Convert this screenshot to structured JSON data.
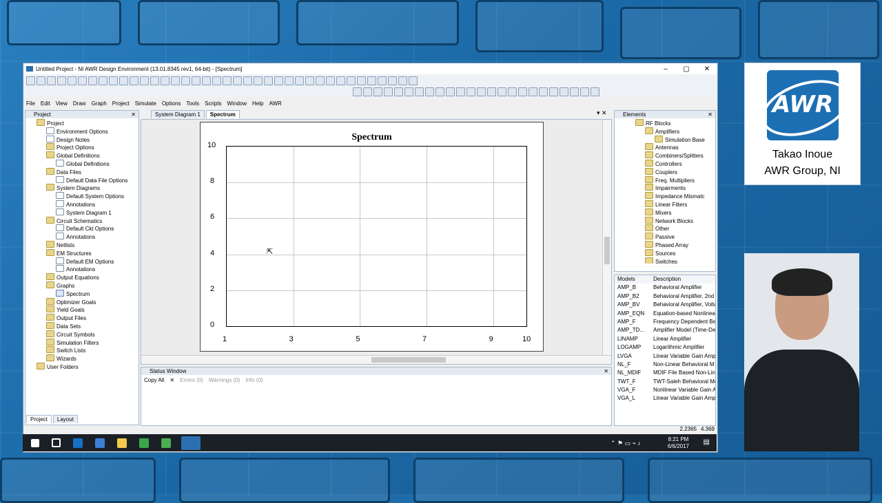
{
  "window": {
    "title": "Untitled Project - NI AWR Design Environment (13.01.8345 rev1, 64-bit) - [Spectrum]",
    "minimize": "–",
    "maximize": "▢",
    "close": "✕"
  },
  "menu": [
    "File",
    "Edit",
    "View",
    "Draw",
    "Graph",
    "Project",
    "Simulate",
    "Options",
    "Tools",
    "Scripts",
    "Window",
    "Help",
    "AWR"
  ],
  "project_panel": {
    "title": "Project",
    "items": [
      {
        "label": "Project",
        "level": 0,
        "icon": "folder"
      },
      {
        "label": "Environment Options",
        "level": 1,
        "icon": "doc"
      },
      {
        "label": "Design Notes",
        "level": 1,
        "icon": "doc"
      },
      {
        "label": "Project Options",
        "level": 1,
        "icon": "folder"
      },
      {
        "label": "Global Definitions",
        "level": 1,
        "icon": "folder"
      },
      {
        "label": "Global Definitions",
        "level": 2,
        "icon": "doc"
      },
      {
        "label": "Data Files",
        "level": 1,
        "icon": "folder"
      },
      {
        "label": "Default Data File Options",
        "level": 2,
        "icon": "doc"
      },
      {
        "label": "System Diagrams",
        "level": 1,
        "icon": "folder"
      },
      {
        "label": "Default System Options",
        "level": 2,
        "icon": "doc"
      },
      {
        "label": "Annotations",
        "level": 2,
        "icon": "doc"
      },
      {
        "label": "System Diagram 1",
        "level": 2,
        "icon": "doc"
      },
      {
        "label": "Circuit Schematics",
        "level": 1,
        "icon": "folder"
      },
      {
        "label": "Default Ckt Options",
        "level": 2,
        "icon": "doc"
      },
      {
        "label": "Annotations",
        "level": 2,
        "icon": "doc"
      },
      {
        "label": "Netlists",
        "level": 1,
        "icon": "folder"
      },
      {
        "label": "EM Structures",
        "level": 1,
        "icon": "folder"
      },
      {
        "label": "Default EM Options",
        "level": 2,
        "icon": "doc"
      },
      {
        "label": "Annotations",
        "level": 2,
        "icon": "doc"
      },
      {
        "label": "Output Equations",
        "level": 1,
        "icon": "folder"
      },
      {
        "label": "Graphs",
        "level": 1,
        "icon": "folder"
      },
      {
        "label": "Spectrum",
        "level": 2,
        "icon": "graph"
      },
      {
        "label": "Optimizer Goals",
        "level": 1,
        "icon": "folder"
      },
      {
        "label": "Yield Goals",
        "level": 1,
        "icon": "folder"
      },
      {
        "label": "Output Files",
        "level": 1,
        "icon": "folder"
      },
      {
        "label": "Data Sets",
        "level": 1,
        "icon": "folder"
      },
      {
        "label": "Circuit Symbols",
        "level": 1,
        "icon": "folder"
      },
      {
        "label": "Simulation Filters",
        "level": 1,
        "icon": "folder"
      },
      {
        "label": "Switch Lists",
        "level": 1,
        "icon": "folder"
      },
      {
        "label": "Wizards",
        "level": 1,
        "icon": "folder"
      },
      {
        "label": "User Folders",
        "level": 0,
        "icon": "folder"
      }
    ],
    "bottom_tabs": [
      "Project",
      "Layout"
    ]
  },
  "doc_tabs": [
    "System Diagram 1",
    "Spectrum"
  ],
  "chart_data": {
    "type": "line",
    "title": "Spectrum",
    "xlabel": "",
    "ylabel": "",
    "xlim": [
      1,
      10
    ],
    "ylim": [
      0,
      10
    ],
    "x_ticks": [
      1,
      3,
      5,
      7,
      9,
      10
    ],
    "y_ticks": [
      0,
      2,
      4,
      6,
      8,
      10
    ],
    "series": [],
    "grid": true
  },
  "status_window": {
    "title": "Status Window",
    "copy_all": "Copy All",
    "errors": "Errors (0)",
    "warnings": "Warnings (0)",
    "info": "Info (0)"
  },
  "elements_panel": {
    "title": "Elements",
    "tree": [
      {
        "label": "RF Blocks",
        "level": 0
      },
      {
        "label": "Amplifiers",
        "level": 1
      },
      {
        "label": "Simulation Base",
        "level": 2
      },
      {
        "label": "Antennas",
        "level": 1
      },
      {
        "label": "Combiners/Splitters",
        "level": 1
      },
      {
        "label": "Controllers",
        "level": 1
      },
      {
        "label": "Couplers",
        "level": 1
      },
      {
        "label": "Freq. Multipliers",
        "level": 1
      },
      {
        "label": "Impairments",
        "level": 1
      },
      {
        "label": "Impedance Mismatc",
        "level": 1
      },
      {
        "label": "Linear Filters",
        "level": 1
      },
      {
        "label": "Mixers",
        "level": 1
      },
      {
        "label": "Network Blocks",
        "level": 1
      },
      {
        "label": "Other",
        "level": 1
      },
      {
        "label": "Passive",
        "level": 1
      },
      {
        "label": "Phased Array",
        "level": 1
      },
      {
        "label": "Sources",
        "level": 1
      },
      {
        "label": "Switches",
        "level": 1
      }
    ],
    "models_header": {
      "models": "Models",
      "description": "Description"
    },
    "models": [
      {
        "name": "AMP_B",
        "desc": "Behavioral Amplifier"
      },
      {
        "name": "AMP_B2",
        "desc": "Behavioral Amplifier, 2nd"
      },
      {
        "name": "AMP_BV",
        "desc": "Behavioral Amplifier, Volta"
      },
      {
        "name": "AMP_EQN",
        "desc": "Equation-based Nonlinea"
      },
      {
        "name": "AMP_F",
        "desc": "Frequency Dependent Beh"
      },
      {
        "name": "AMP_TD...",
        "desc": "Amplifier Model (Time-De"
      },
      {
        "name": "LINAMP",
        "desc": "Linear Amplifier"
      },
      {
        "name": "LOGAMP",
        "desc": "Logarithmic Amplifier"
      },
      {
        "name": "LVGA",
        "desc": "Linear Variable Gain Ampl"
      },
      {
        "name": "NL_F",
        "desc": "Non-Linear Behavioral M"
      },
      {
        "name": "NL_MDIF",
        "desc": "MDIF File Based Non-Line"
      },
      {
        "name": "TWT_F",
        "desc": "TWT-Saleh Behavioral Mo"
      },
      {
        "name": "VGA_F",
        "desc": "Nonlinear Variable Gain A"
      },
      {
        "name": "VGA_L",
        "desc": "Linear Variable Gain Ampl"
      }
    ]
  },
  "coords": {
    "x": "2.2365",
    "y": "4.369"
  },
  "taskbar": {
    "time": "8:21 PM",
    "date": "6/6/2017"
  },
  "presenter": {
    "logo": "AWR",
    "name": "Takao Inoue",
    "org": "AWR Group, NI"
  }
}
